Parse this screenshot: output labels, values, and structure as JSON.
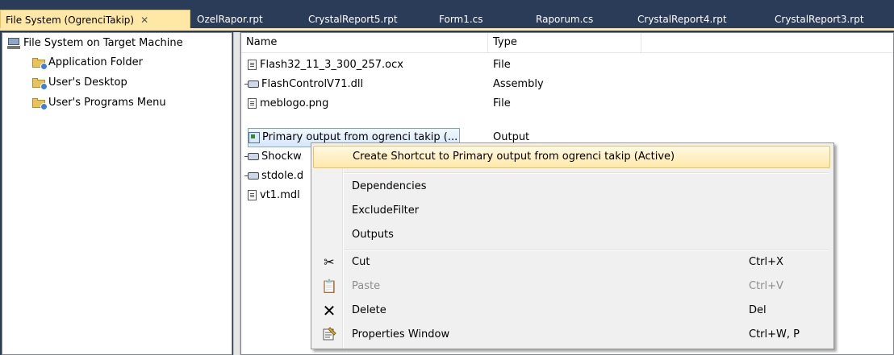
{
  "tabs": [
    {
      "label": "File System (OgrenciTakip)",
      "active": true
    },
    {
      "label": "OzelRapor.rpt"
    },
    {
      "label": "CrystalReport5.rpt"
    },
    {
      "label": "Form1.cs"
    },
    {
      "label": "Raporum.cs"
    },
    {
      "label": "CrystalReport4.rpt"
    },
    {
      "label": "CrystalReport3.rpt"
    }
  ],
  "tab_close_glyph": "✕",
  "tree": {
    "root": "File System on Target Machine",
    "items": [
      "Application Folder",
      "User's Desktop",
      "User's Programs Menu"
    ]
  },
  "list": {
    "columns": {
      "name": "Name",
      "type": "Type"
    },
    "rows": [
      {
        "name": "Flash32_11_3_300_257.ocx",
        "type": "File",
        "icon": "file-icon"
      },
      {
        "name": "FlashControlV71.dll",
        "type": "Assembly",
        "icon": "assembly-icon"
      },
      {
        "name": "meblogo.png",
        "type": "File",
        "icon": "file-icon"
      },
      {
        "name": "Primary output from ogrenci takip (...",
        "type": "Output",
        "icon": "output-icon"
      },
      {
        "name": "Shockw",
        "type": "",
        "icon": "assembly-icon"
      },
      {
        "name": "stdole.d",
        "type": "",
        "icon": "assembly-icon"
      },
      {
        "name": "vt1.mdl",
        "type": "",
        "icon": "file-icon"
      }
    ]
  },
  "context_menu": {
    "create_shortcut": "Create Shortcut to Primary output from ogrenci takip (Active)",
    "dependencies": "Dependencies",
    "exclude_filter": "ExcludeFilter",
    "outputs": "Outputs",
    "cut": {
      "label": "Cut",
      "shortcut": "Ctrl+X"
    },
    "paste": {
      "label": "Paste",
      "shortcut": "Ctrl+V"
    },
    "delete": {
      "label": "Delete",
      "shortcut": "Del"
    },
    "properties": {
      "label": "Properties Window",
      "shortcut": "Ctrl+W, P"
    }
  },
  "colors": {
    "background": "#2b3c59",
    "active_tab": "#ffe8a6",
    "highlight": "#ffe9a8"
  }
}
